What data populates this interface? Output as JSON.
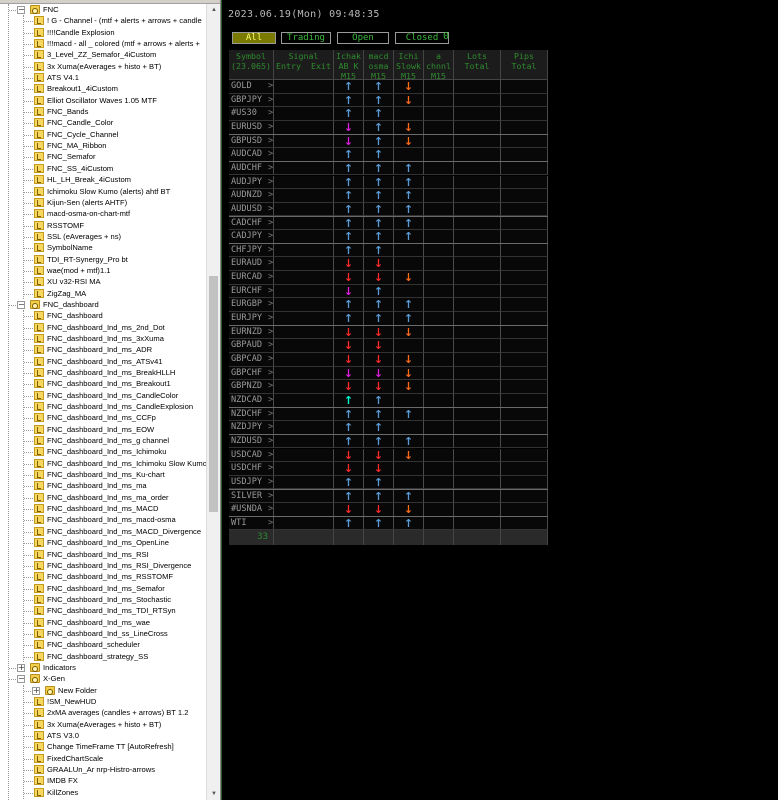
{
  "navigator": {
    "rows": [
      {
        "label": "FNC",
        "depth": 1,
        "type": "folder",
        "expander": "−"
      },
      {
        "label": "! G - Channel - (mtf + alerts + arrows + candle",
        "depth": 2,
        "type": "ind"
      },
      {
        "label": "!!!!Candle Explosion",
        "depth": 2,
        "type": "ind"
      },
      {
        "label": "!!!macd - all _ colored (mtf + arrows + alerts +",
        "depth": 2,
        "type": "ind"
      },
      {
        "label": "3_Level_ZZ_Semafor_4iCustom",
        "depth": 2,
        "type": "ind"
      },
      {
        "label": "3x Xuma(eAverages + histo + BT)",
        "depth": 2,
        "type": "ind"
      },
      {
        "label": "ATS V4.1",
        "depth": 2,
        "type": "ind"
      },
      {
        "label": "Breakout1_4iCustom",
        "depth": 2,
        "type": "ind"
      },
      {
        "label": "Elliot Oscillator Waves 1.05 MTF",
        "depth": 2,
        "type": "ind"
      },
      {
        "label": "FNC_Bands",
        "depth": 2,
        "type": "ind"
      },
      {
        "label": "FNC_Candle_Color",
        "depth": 2,
        "type": "ind"
      },
      {
        "label": "FNC_Cycle_Channel",
        "depth": 2,
        "type": "ind"
      },
      {
        "label": "FNC_MA_Ribbon",
        "depth": 2,
        "type": "ind"
      },
      {
        "label": "FNC_Semafor",
        "depth": 2,
        "type": "ind"
      },
      {
        "label": "FNC_SS_4iCustom",
        "depth": 2,
        "type": "ind"
      },
      {
        "label": "HL_LH_Break_4iCustom",
        "depth": 2,
        "type": "ind"
      },
      {
        "label": "Ichimoku Slow Kumo (alerts) ahtf BT",
        "depth": 2,
        "type": "ind"
      },
      {
        "label": "Kijun-Sen (alerts AHTF)",
        "depth": 2,
        "type": "ind"
      },
      {
        "label": "macd-osma-on-chart-mtf",
        "depth": 2,
        "type": "ind"
      },
      {
        "label": "RSSTOMF",
        "depth": 2,
        "type": "ind"
      },
      {
        "label": "SSL (eAverages + ns)",
        "depth": 2,
        "type": "ind"
      },
      {
        "label": "SymbolName",
        "depth": 2,
        "type": "ind"
      },
      {
        "label": "TDI_RT-Synergy_Pro bt",
        "depth": 2,
        "type": "ind"
      },
      {
        "label": "wae(mod + mtf)1.1",
        "depth": 2,
        "type": "ind"
      },
      {
        "label": "XU v32-RSI MA",
        "depth": 2,
        "type": "ind"
      },
      {
        "label": "ZigZag_MA",
        "depth": 2,
        "type": "ind"
      },
      {
        "label": "FNC_dashboard",
        "depth": 1,
        "type": "folder",
        "expander": "−"
      },
      {
        "label": "FNC_dashboard",
        "depth": 2,
        "type": "ind"
      },
      {
        "label": "FNC_dashboard_Ind_ms_2nd_Dot",
        "depth": 2,
        "type": "ind"
      },
      {
        "label": "FNC_dashboard_Ind_ms_3xXuma",
        "depth": 2,
        "type": "ind"
      },
      {
        "label": "FNC_dashboard_Ind_ms_ADR",
        "depth": 2,
        "type": "ind"
      },
      {
        "label": "FNC_dashboard_Ind_ms_ATSv41",
        "depth": 2,
        "type": "ind"
      },
      {
        "label": "FNC_dashboard_Ind_ms_BreakHLLH",
        "depth": 2,
        "type": "ind"
      },
      {
        "label": "FNC_dashboard_Ind_ms_Breakout1",
        "depth": 2,
        "type": "ind"
      },
      {
        "label": "FNC_dashboard_Ind_ms_CandleColor",
        "depth": 2,
        "type": "ind"
      },
      {
        "label": "FNC_dashboard_Ind_ms_CandleExplosion",
        "depth": 2,
        "type": "ind"
      },
      {
        "label": "FNC_dashboard_Ind_ms_CCFp",
        "depth": 2,
        "type": "ind"
      },
      {
        "label": "FNC_dashboard_Ind_ms_EOW",
        "depth": 2,
        "type": "ind"
      },
      {
        "label": "FNC_dashboard_Ind_ms_g channel",
        "depth": 2,
        "type": "ind"
      },
      {
        "label": "FNC_dashboard_Ind_ms_Ichimoku",
        "depth": 2,
        "type": "ind"
      },
      {
        "label": "FNC_dashboard_Ind_ms_Ichimoku Slow Kumo",
        "depth": 2,
        "type": "ind"
      },
      {
        "label": "FNC_dashboard_Ind_ms_Ku-chart",
        "depth": 2,
        "type": "ind"
      },
      {
        "label": "FNC_dashboard_Ind_ms_ma",
        "depth": 2,
        "type": "ind"
      },
      {
        "label": "FNC_dashboard_Ind_ms_ma_order",
        "depth": 2,
        "type": "ind"
      },
      {
        "label": "FNC_dashboard_Ind_ms_MACD",
        "depth": 2,
        "type": "ind"
      },
      {
        "label": "FNC_dashboard_Ind_ms_macd-osma",
        "depth": 2,
        "type": "ind"
      },
      {
        "label": "FNC_dashboard_Ind_ms_MACD_Divergence",
        "depth": 2,
        "type": "ind"
      },
      {
        "label": "FNC_dashboard_Ind_ms_OpenLine",
        "depth": 2,
        "type": "ind"
      },
      {
        "label": "FNC_dashboard_Ind_ms_RSI",
        "depth": 2,
        "type": "ind"
      },
      {
        "label": "FNC_dashboard_Ind_ms_RSI_Divergence",
        "depth": 2,
        "type": "ind"
      },
      {
        "label": "FNC_dashboard_Ind_ms_RSSTOMF",
        "depth": 2,
        "type": "ind"
      },
      {
        "label": "FNC_dashboard_Ind_ms_Semafor",
        "depth": 2,
        "type": "ind"
      },
      {
        "label": "FNC_dashboard_Ind_ms_Stochastic",
        "depth": 2,
        "type": "ind"
      },
      {
        "label": "FNC_dashboard_Ind_ms_TDI_RTSyn",
        "depth": 2,
        "type": "ind"
      },
      {
        "label": "FNC_dashboard_Ind_ms_wae",
        "depth": 2,
        "type": "ind"
      },
      {
        "label": "FNC_dashboard_Ind_ss_LineCross",
        "depth": 2,
        "type": "ind"
      },
      {
        "label": "FNC_dashboard_scheduler",
        "depth": 2,
        "type": "ind"
      },
      {
        "label": "FNC_dashboard_strategy_SS",
        "depth": 2,
        "type": "ind"
      },
      {
        "label": "Indicators",
        "depth": 1,
        "type": "folder",
        "expander": "+"
      },
      {
        "label": "X-Gen",
        "depth": 1,
        "type": "folder",
        "expander": "−"
      },
      {
        "label": "New Folder",
        "depth": 2,
        "type": "folder",
        "expander": "+"
      },
      {
        "label": "!SM_NewHUD",
        "depth": 2,
        "type": "ind"
      },
      {
        "label": "2xMA averages (candles + arrows) BT 1.2",
        "depth": 2,
        "type": "ind"
      },
      {
        "label": "3x Xuma(eAverages + histo + BT)",
        "depth": 2,
        "type": "ind"
      },
      {
        "label": "ATS V3.0",
        "depth": 2,
        "type": "ind"
      },
      {
        "label": "Change TimeFrame TT [AutoRefresh]",
        "depth": 2,
        "type": "ind"
      },
      {
        "label": "FixedChartScale",
        "depth": 2,
        "type": "ind"
      },
      {
        "label": "GRAALUn_Ar nrp-Histro-arrows",
        "depth": 2,
        "type": "ind"
      },
      {
        "label": "IMDB FX",
        "depth": 2,
        "type": "ind"
      },
      {
        "label": "KillZones",
        "depth": 2,
        "type": "ind"
      }
    ],
    "scroll_up": "▲",
    "scroll_down": "▼"
  },
  "chart": {
    "datetime": "2023.06.19(Mon) 09:48:35",
    "filters": {
      "all": "All",
      "trading": "Trading",
      "open": "Open",
      "closed": "Closed",
      "count": "0"
    },
    "headers": [
      {
        "id": "symbol",
        "text": "Symbol\n(23.065)"
      },
      {
        "id": "signal",
        "text": "Signal\nEntry  Exit"
      },
      {
        "id": "ichak",
        "text": "Ichak\nAB K\nM15"
      },
      {
        "id": "macd",
        "text": "macd\nosma\nM15"
      },
      {
        "id": "ichi",
        "text": "Ichi\nSlowk\nM15"
      },
      {
        "id": "chnl",
        "text": "a\nchnnl\nM15"
      },
      {
        "id": "lots",
        "text": "Lots\nTotal"
      },
      {
        "id": "pips",
        "text": "Pips\nTotal"
      }
    ],
    "rows": [
      {
        "symbol": "GOLD",
        "a": "up-blue",
        "b": "up-blue",
        "c": "down-orange"
      },
      {
        "symbol": "GBPJPY",
        "a": "up-blue",
        "b": "up-blue",
        "c": "down-orange"
      },
      {
        "symbol": "#US30",
        "a": "up-blue",
        "b": "up-blue",
        "c": ""
      },
      {
        "symbol": "EURUSD",
        "a": "down-magenta",
        "b": "up-blue",
        "c": "down-orange"
      },
      {
        "symbol": "GBPUSD",
        "a": "down-magenta",
        "b": "up-blue",
        "c": "down-orange"
      },
      {
        "symbol": "AUDCAD",
        "a": "up-blue",
        "b": "up-blue",
        "c": ""
      },
      {
        "symbol": "AUDCHF",
        "a": "up-blue",
        "b": "up-blue",
        "c": "up-blue"
      },
      {
        "symbol": "AUDJPY",
        "a": "up-blue",
        "b": "up-blue",
        "c": "up-blue"
      },
      {
        "symbol": "AUDNZD",
        "a": "up-blue",
        "b": "up-blue",
        "c": "up-blue"
      },
      {
        "symbol": "AUDUSD",
        "a": "up-blue",
        "b": "up-blue",
        "c": "up-blue"
      },
      {
        "symbol": "CADCHF",
        "a": "up-blue",
        "b": "up-blue",
        "c": "up-blue"
      },
      {
        "symbol": "CADJPY",
        "a": "up-blue",
        "b": "up-blue",
        "c": "up-blue"
      },
      {
        "symbol": "CHFJPY",
        "a": "up-blue",
        "b": "up-blue",
        "c": ""
      },
      {
        "symbol": "EURAUD",
        "a": "down-red",
        "b": "down-red",
        "c": ""
      },
      {
        "symbol": "EURCAD",
        "a": "down-red",
        "b": "down-red",
        "c": "down-orange"
      },
      {
        "symbol": "EURCHF",
        "a": "down-magenta",
        "b": "up-blue",
        "c": ""
      },
      {
        "symbol": "EURGBP",
        "a": "up-blue",
        "b": "up-blue",
        "c": "up-blue"
      },
      {
        "symbol": "EURJPY",
        "a": "up-blue",
        "b": "up-blue",
        "c": "up-blue"
      },
      {
        "symbol": "EURNZD",
        "a": "down-red",
        "b": "down-red",
        "c": "down-orange"
      },
      {
        "symbol": "GBPAUD",
        "a": "down-red",
        "b": "down-red",
        "c": ""
      },
      {
        "symbol": "GBPCAD",
        "a": "down-red",
        "b": "down-red",
        "c": "down-orange"
      },
      {
        "symbol": "GBPCHF",
        "a": "down-magenta",
        "b": "down-magenta",
        "c": "down-orange"
      },
      {
        "symbol": "GBPNZD",
        "a": "down-red",
        "b": "down-red",
        "c": "down-orange"
      },
      {
        "symbol": "NZDCAD",
        "a": "up-cyan",
        "b": "up-blue",
        "c": ""
      },
      {
        "symbol": "NZDCHF",
        "a": "up-blue",
        "b": "up-blue",
        "c": "up-blue"
      },
      {
        "symbol": "NZDJPY",
        "a": "up-blue",
        "b": "up-blue",
        "c": ""
      },
      {
        "symbol": "NZDUSD",
        "a": "up-blue",
        "b": "up-blue",
        "c": "up-blue"
      },
      {
        "symbol": "USDCAD",
        "a": "down-red",
        "b": "down-red",
        "c": "down-orange"
      },
      {
        "symbol": "USDCHF",
        "a": "down-red",
        "b": "down-red",
        "c": ""
      },
      {
        "symbol": "USDJPY",
        "a": "up-blue",
        "b": "up-blue",
        "c": ""
      },
      {
        "symbol": "SILVER",
        "a": "up-blue",
        "b": "up-blue",
        "c": "up-blue"
      },
      {
        "symbol": "#USNDA",
        "a": "down-red",
        "b": "down-red",
        "c": "down-orange"
      },
      {
        "symbol": "WTI",
        "a": "up-blue",
        "b": "up-blue",
        "c": "up-blue"
      }
    ],
    "footer_count": "33",
    "arrow_colors": {
      "up-blue": "#5b9bd5",
      "up-cyan": "#00ffd0",
      "down-red": "#ff2b2b",
      "down-orange": "#ff6a1a",
      "down-magenta": "#e01ee0"
    },
    "arrow_glyphs": {
      "up": "↑",
      "down": "↓"
    },
    "symbol_suffix": ">"
  }
}
